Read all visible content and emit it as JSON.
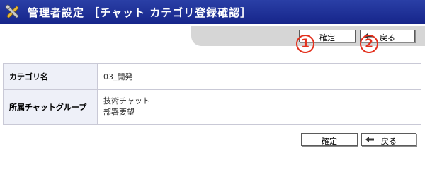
{
  "header": {
    "title": "管理者設定 ［チャット カテゴリ登録確認］",
    "icon": "tools-icon",
    "background_color": "#1c2d98"
  },
  "toolbar_top": {
    "confirm_label": "確定",
    "back_label": "戻る",
    "confirm_badge": "1",
    "back_badge": "2"
  },
  "details": {
    "category_name_label": "カテゴリ名",
    "category_name_value": "03_開発",
    "group_label": "所属チャットグループ",
    "group_values": [
      "技術チャット",
      "部署要望"
    ]
  },
  "toolbar_bottom": {
    "confirm_label": "確定",
    "back_label": "戻る"
  },
  "colors": {
    "badge": "#e3301d",
    "header_cell": "#eef0f8",
    "band": "#d6d6d6"
  }
}
